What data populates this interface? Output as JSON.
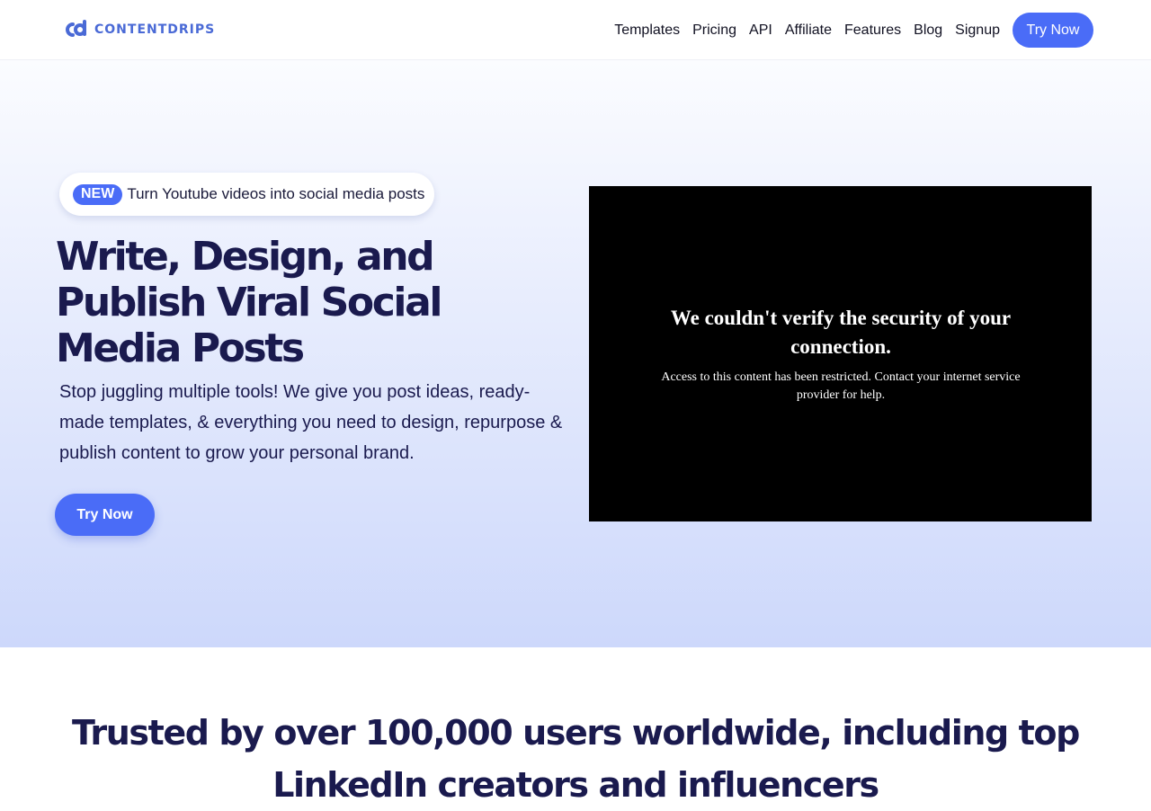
{
  "header": {
    "logo_text": "CONTENTDRIPS",
    "nav": [
      {
        "label": "Templates"
      },
      {
        "label": "Pricing"
      },
      {
        "label": "API"
      },
      {
        "label": "Affiliate"
      },
      {
        "label": "Features"
      },
      {
        "label": "Blog"
      },
      {
        "label": "Signup"
      }
    ],
    "cta_label": "Try Now"
  },
  "hero": {
    "badge": "NEW",
    "announcement": "Turn Youtube videos into social media posts",
    "title": "Write, Design, and Publish Viral Social Media Posts",
    "subtitle": "Stop juggling multiple tools! We give you post ideas, ready-made templates, & everything you need to design, repurpose & publish content to grow your personal brand.",
    "cta_label": "Try Now"
  },
  "video": {
    "error_title": "We couldn't verify the security of your connection.",
    "error_message": "Access to this content has been restricted. Contact your internet service provider for help."
  },
  "trusted": {
    "heading": "Trusted by over 100,000 users worldwide, including top LinkedIn creators and influencers"
  },
  "colors": {
    "accent": "#4a6cf7",
    "heading": "#1a1a4e",
    "logo": "#4a6ad6"
  }
}
